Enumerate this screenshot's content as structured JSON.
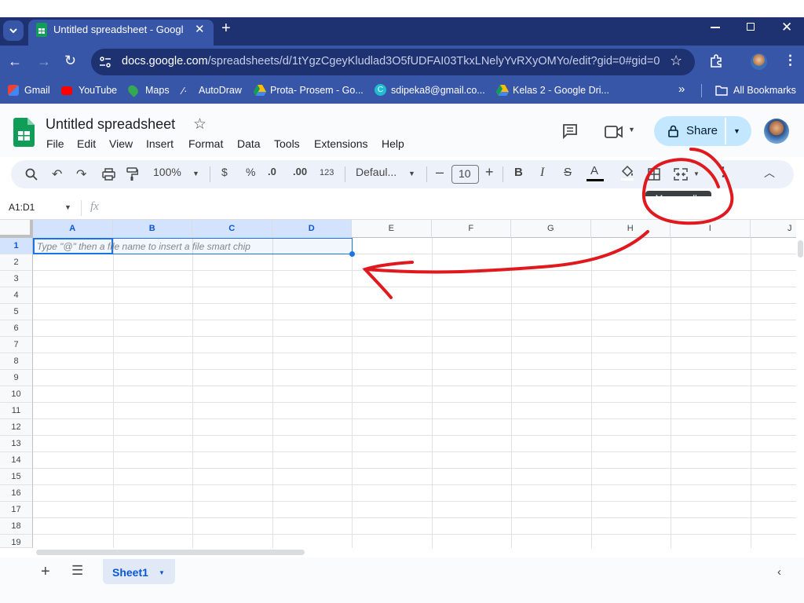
{
  "browser": {
    "tab_title": "Untitled spreadsheet - Google S",
    "url_domain": "docs.google.com",
    "url_path": "/spreadsheets/d/1tYgzCgeyKludlad3O5fUDFAI03TkxLNelyYvRXyOMYo/edit?gid=0#gid=0",
    "bookmarks": [
      "Gmail",
      "YouTube",
      "Maps",
      "AutoDraw",
      "Prota- Prosem - Go...",
      "sdipeka8@gmail.co...",
      "Kelas 2 - Google Dri..."
    ],
    "all_bookmarks": "All Bookmarks",
    "more_bookmarks": "»"
  },
  "doc": {
    "title": "Untitled spreadsheet",
    "menu": [
      "File",
      "Edit",
      "View",
      "Insert",
      "Format",
      "Data",
      "Tools",
      "Extensions",
      "Help"
    ],
    "share_label": "Share"
  },
  "toolbar": {
    "zoom": "100%",
    "currency": "$",
    "percent": "%",
    "decrease_decimal": ".0",
    "increase_decimal": ".00",
    "number_format": "123",
    "font": "Defaul...",
    "font_size": "10",
    "bold": "B",
    "italic": "I",
    "tooltip": "Merge cells"
  },
  "formula_bar": {
    "name_box": "A1:D1",
    "fx": "fx"
  },
  "grid": {
    "columns": [
      "A",
      "B",
      "C",
      "D",
      "E",
      "F",
      "G",
      "H",
      "I",
      "J"
    ],
    "rows": [
      "1",
      "2",
      "3",
      "4",
      "5",
      "6",
      "7",
      "8",
      "9",
      "10",
      "11",
      "12",
      "13",
      "14",
      "15",
      "16",
      "17",
      "18",
      "19"
    ],
    "cell_placeholder": "Type \"@\" then a file name to insert a file smart chip",
    "selected_range": "A1:D1"
  },
  "sheets": {
    "active": "Sheet1"
  },
  "colors": {
    "tab_bar": "#1e3171",
    "chrome": "#3856a8",
    "selection": "#1a73e8",
    "share_bg": "#c2e7ff",
    "annotation": "#e0191f"
  }
}
